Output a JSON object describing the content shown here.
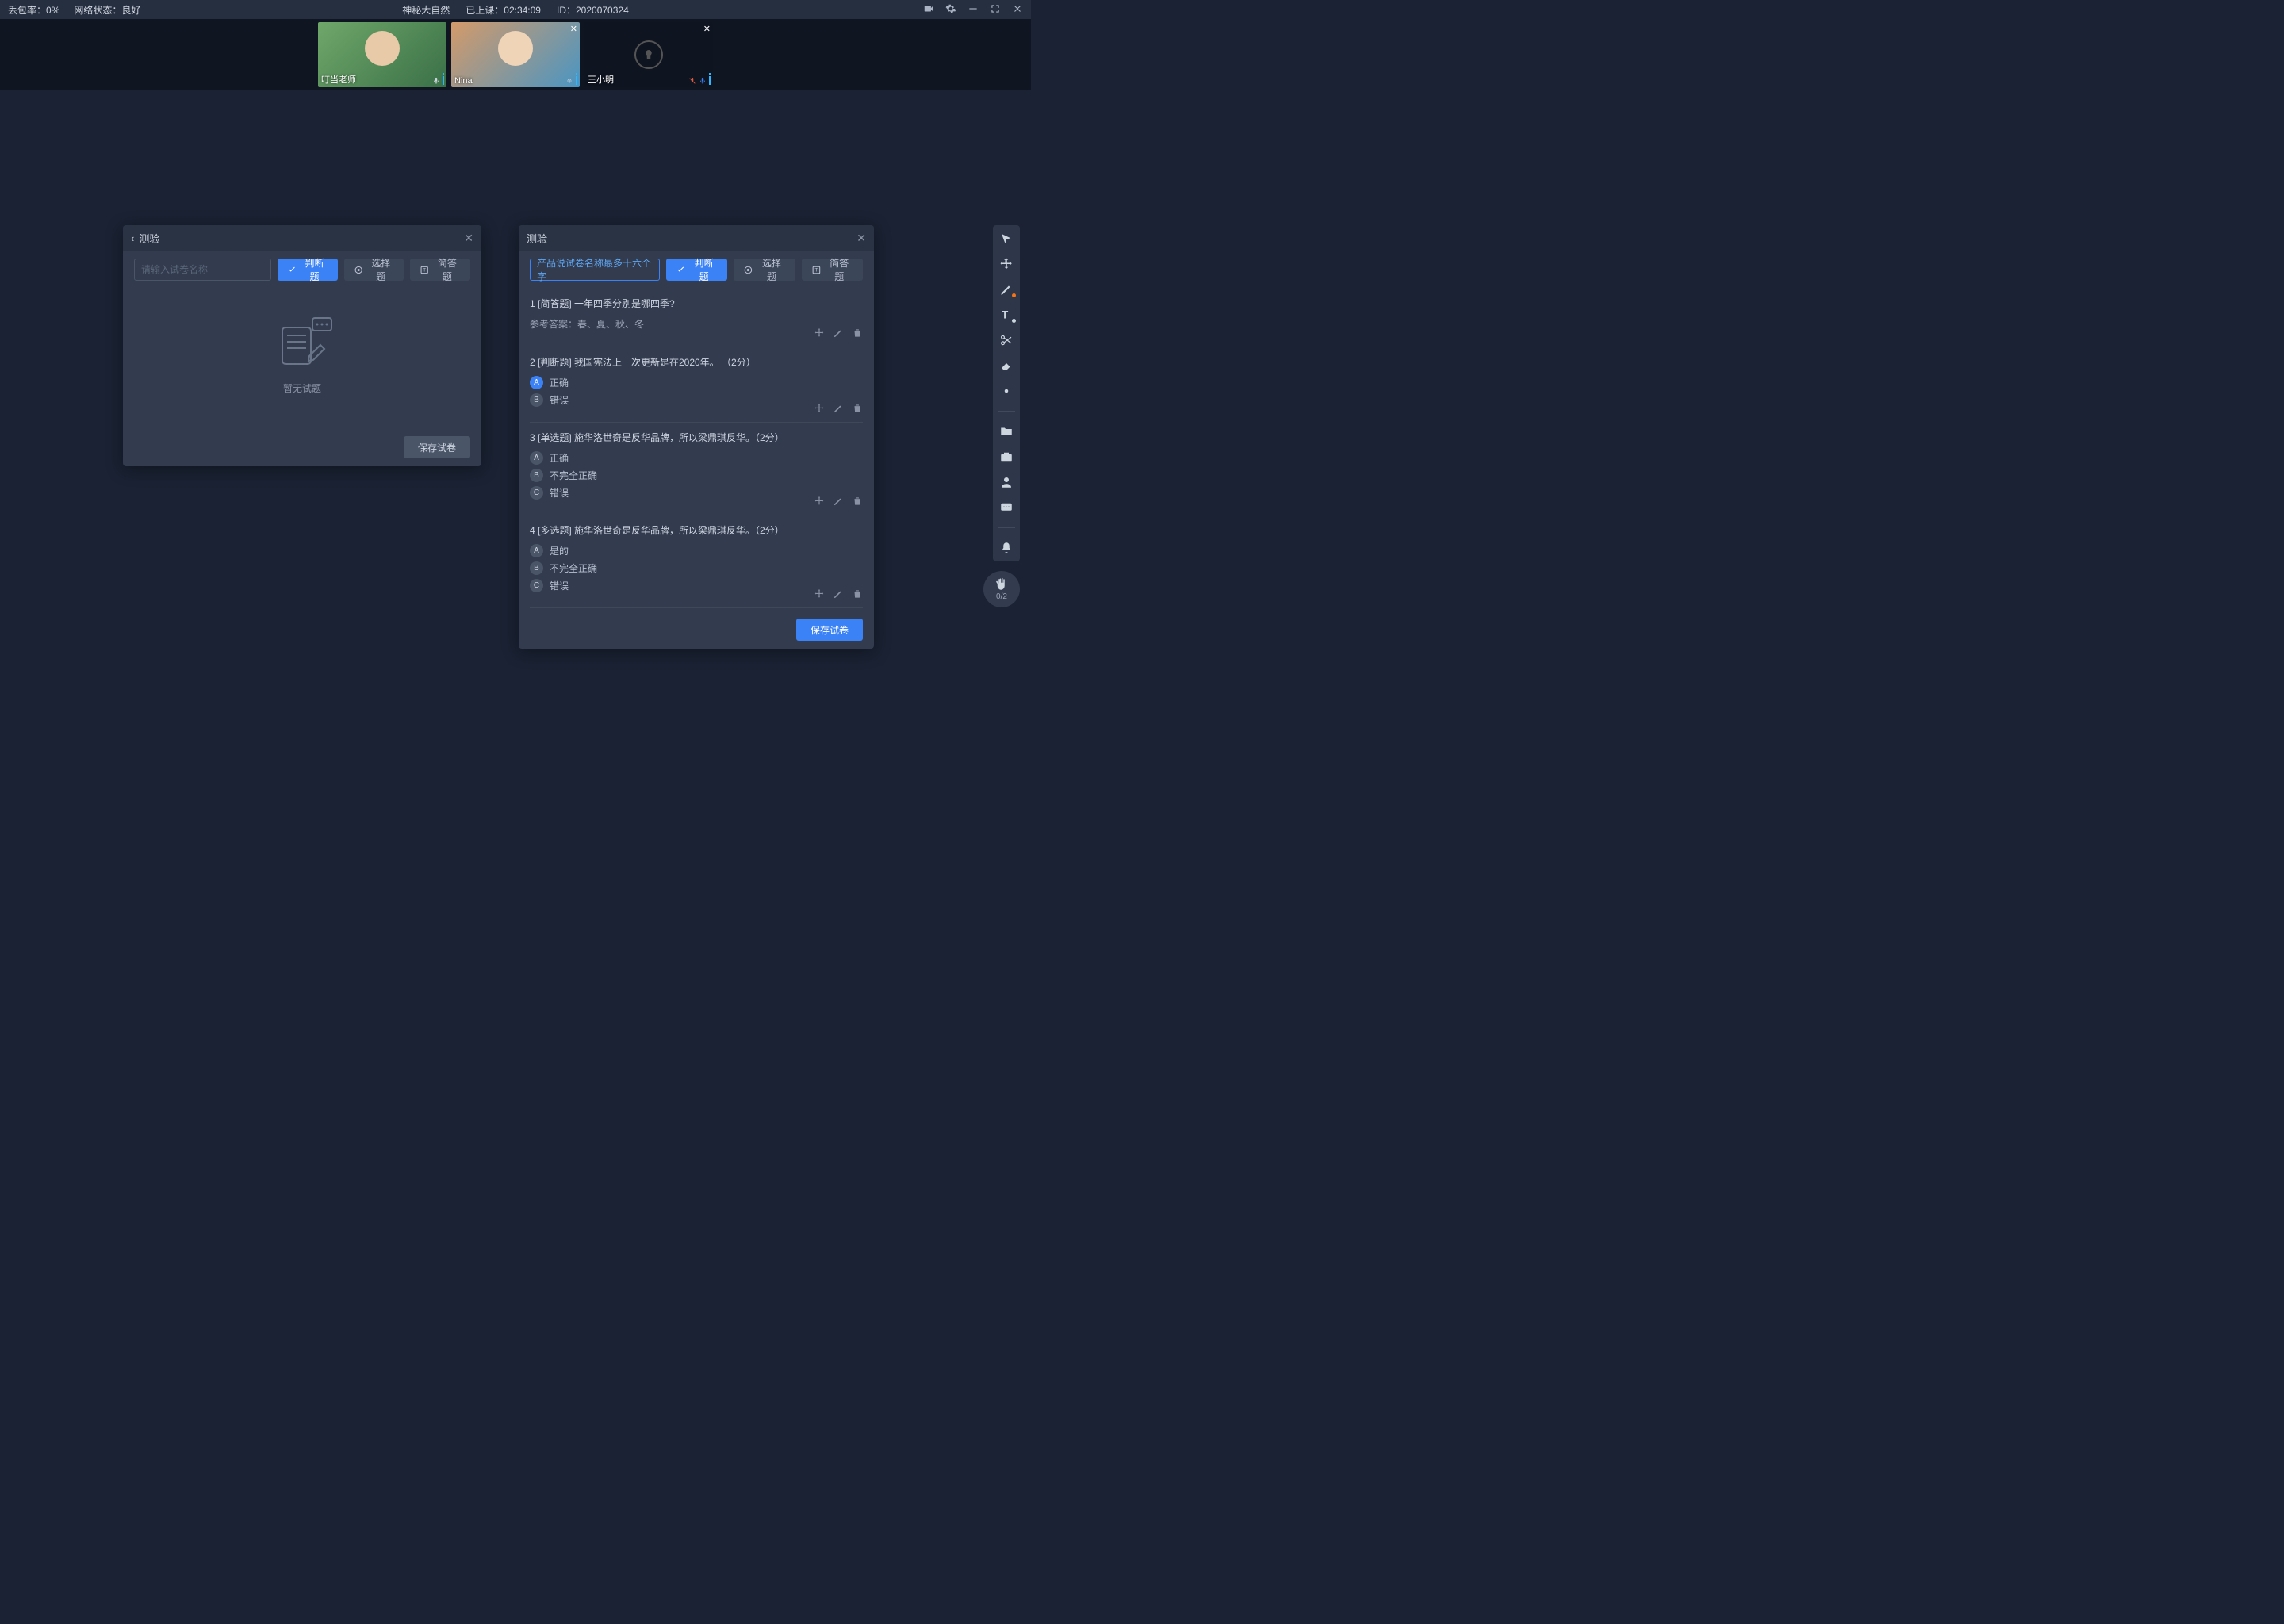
{
  "topbar": {
    "packet_loss_label": "丢包率：",
    "packet_loss_value": "0%",
    "network_label": "网络状态：",
    "network_value": "良好",
    "room_title": "神秘大自然",
    "elapsed_label": "已上课：",
    "elapsed_value": "02:34:09",
    "id_label": "ID：",
    "id_value": "2020070324"
  },
  "videos": [
    {
      "name": "叮当老师",
      "role": "teacher",
      "camera_on": true,
      "closeable": false
    },
    {
      "name": "Nina",
      "role": "student",
      "camera_on": true,
      "closeable": true
    },
    {
      "name": "王小明",
      "role": "student",
      "camera_on": false,
      "closeable": true
    }
  ],
  "quiz_left": {
    "title": "测验",
    "name_placeholder": "请输入试卷名称",
    "buttons": {
      "judge": "判断题",
      "choice": "选择题",
      "short": "简答题"
    },
    "empty_text": "暂无试题",
    "save": "保存试卷"
  },
  "quiz_right": {
    "title": "测验",
    "name_value": "产品说试卷名称最多十六个字",
    "buttons": {
      "judge": "判断题",
      "choice": "选择题",
      "short": "简答题"
    },
    "save": "保存试卷",
    "answer_label": "参考答案：",
    "questions": [
      {
        "index": "1",
        "type_label": "[简答题]",
        "text": "一年四季分别是哪四季?",
        "answer": "春、夏、秋、冬",
        "options": []
      },
      {
        "index": "2",
        "type_label": "[判断题]",
        "text": "我国宪法上一次更新是在2020年。 （2分）",
        "options": [
          {
            "letter": "A",
            "text": "正确",
            "selected": true
          },
          {
            "letter": "B",
            "text": "错误",
            "selected": false
          }
        ]
      },
      {
        "index": "3",
        "type_label": "[单选题]",
        "text": "施华洛世奇是反华品牌，所以梁鼎琪反华。（2分）",
        "options": [
          {
            "letter": "A",
            "text": "正确",
            "selected": false
          },
          {
            "letter": "B",
            "text": "不完全正确",
            "selected": false
          },
          {
            "letter": "C",
            "text": "错误",
            "selected": false
          }
        ]
      },
      {
        "index": "4",
        "type_label": "[多选题]",
        "text": "施华洛世奇是反华品牌，所以梁鼎琪反华。（2分）",
        "options": [
          {
            "letter": "A",
            "text": "是的",
            "selected": false
          },
          {
            "letter": "B",
            "text": "不完全正确",
            "selected": false
          },
          {
            "letter": "C",
            "text": "错误",
            "selected": false
          }
        ]
      }
    ]
  },
  "hand_raise": {
    "count": "0/2"
  }
}
